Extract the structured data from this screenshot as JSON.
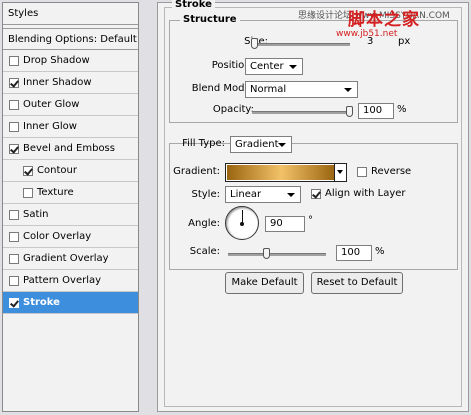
{
  "styles_panel": {
    "title": "Styles",
    "blending_options": "Blending Options: Default",
    "items": [
      {
        "label": "Drop Shadow",
        "checked": false
      },
      {
        "label": "Inner Shadow",
        "checked": true
      },
      {
        "label": "Outer Glow",
        "checked": false
      },
      {
        "label": "Inner Glow",
        "checked": false
      },
      {
        "label": "Bevel and Emboss",
        "checked": true
      },
      {
        "label": "Contour",
        "checked": true
      },
      {
        "label": "Texture",
        "checked": false
      },
      {
        "label": "Satin",
        "checked": false
      },
      {
        "label": "Color Overlay",
        "checked": false
      },
      {
        "label": "Gradient Overlay",
        "checked": false
      },
      {
        "label": "Pattern Overlay",
        "checked": false
      },
      {
        "label": "Stroke",
        "checked": true
      }
    ]
  },
  "stroke": {
    "title": "Stroke",
    "watermark": "思缘设计论坛 www.MISSYUAN.COM",
    "watermark_brand": "脚本之家",
    "watermark_url": "www.jb51.net",
    "structure": {
      "title": "Structure",
      "size_label": "Size:",
      "size_value": "3",
      "size_unit": "px",
      "position_label": "Position:",
      "position_value": "Center",
      "blend_mode_label": "Blend Mode:",
      "blend_mode_value": "Normal",
      "opacity_label": "Opacity:",
      "opacity_value": "100",
      "opacity_unit": "%",
      "opacity_level": 1.0
    },
    "fill": {
      "fill_type_label": "Fill Type:",
      "fill_type_value": "Gradient",
      "gradient_label": "Gradient:",
      "reverse_label": "Reverse",
      "reverse_checked": false,
      "style_label": "Style:",
      "style_value": "Linear",
      "align_label": "Align with Layer",
      "align_checked": true,
      "angle_label": "Angle:",
      "angle_value": "90",
      "angle_unit": "°",
      "scale_label": "Scale:",
      "scale_value": "100",
      "scale_unit": "%",
      "scale_level": 0.4
    },
    "make_default_label": "Make Default",
    "reset_default_label": "Reset to Default"
  },
  "colors": {
    "selection": "#3e8ede",
    "watermark_red": "#d42020",
    "gradient_dark": "#9a6410",
    "gradient_light": "#f2c268"
  },
  "icons": {
    "checkbox": "check-mark",
    "dropdown": "chevron-down-icon",
    "angle_dial": "angle-dial-icon"
  }
}
